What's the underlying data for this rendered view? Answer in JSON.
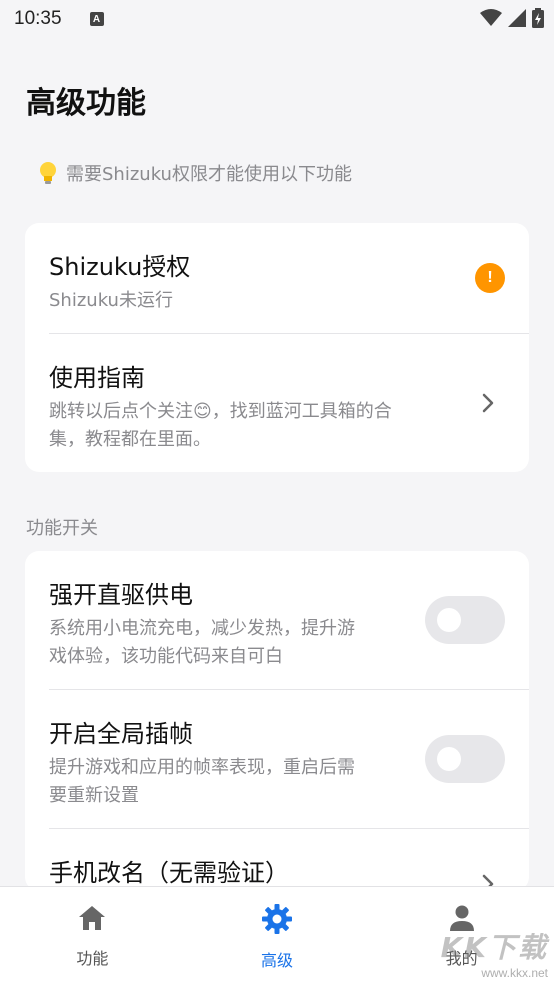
{
  "status": {
    "time": "10:35",
    "notification_glyph": "A"
  },
  "page": {
    "title": "高级功能",
    "hint": "需要Shizuku权限才能使用以下功能"
  },
  "card1": {
    "shizuku_title": "Shizuku授权",
    "shizuku_sub": "Shizuku未运行",
    "warn_glyph": "!",
    "guide_title": "使用指南",
    "guide_sub_1": "跳转以后点个关注😊，找到蓝河工具箱的合",
    "guide_sub_2": "集，教程都在里面。"
  },
  "section": {
    "label": "功能开关"
  },
  "card2": {
    "item1_title": "强开直驱供电",
    "item1_sub_1": "系统用小电流充电，减少发热，提升游",
    "item1_sub_2": "戏体验，该功能代码来自可白",
    "item1_on": false,
    "item2_title": "开启全局插帧",
    "item2_sub_1": "提升游戏和应用的帧率表现，重启后需",
    "item2_sub_2": "要重新设置",
    "item2_on": false,
    "item3_title": "手机改名（无需验证）"
  },
  "nav": {
    "items": [
      {
        "label": "功能",
        "icon": "home-icon"
      },
      {
        "label": "高级",
        "icon": "gear-icon"
      },
      {
        "label": "我的",
        "icon": "person-icon"
      }
    ],
    "active_color": "#1a73e8",
    "inactive_color": "#666666"
  },
  "watermark": {
    "big": "KK下载",
    "small": "www.kkx.net"
  },
  "colors": {
    "warn": "#ff9500",
    "accent": "#1a73e8"
  }
}
